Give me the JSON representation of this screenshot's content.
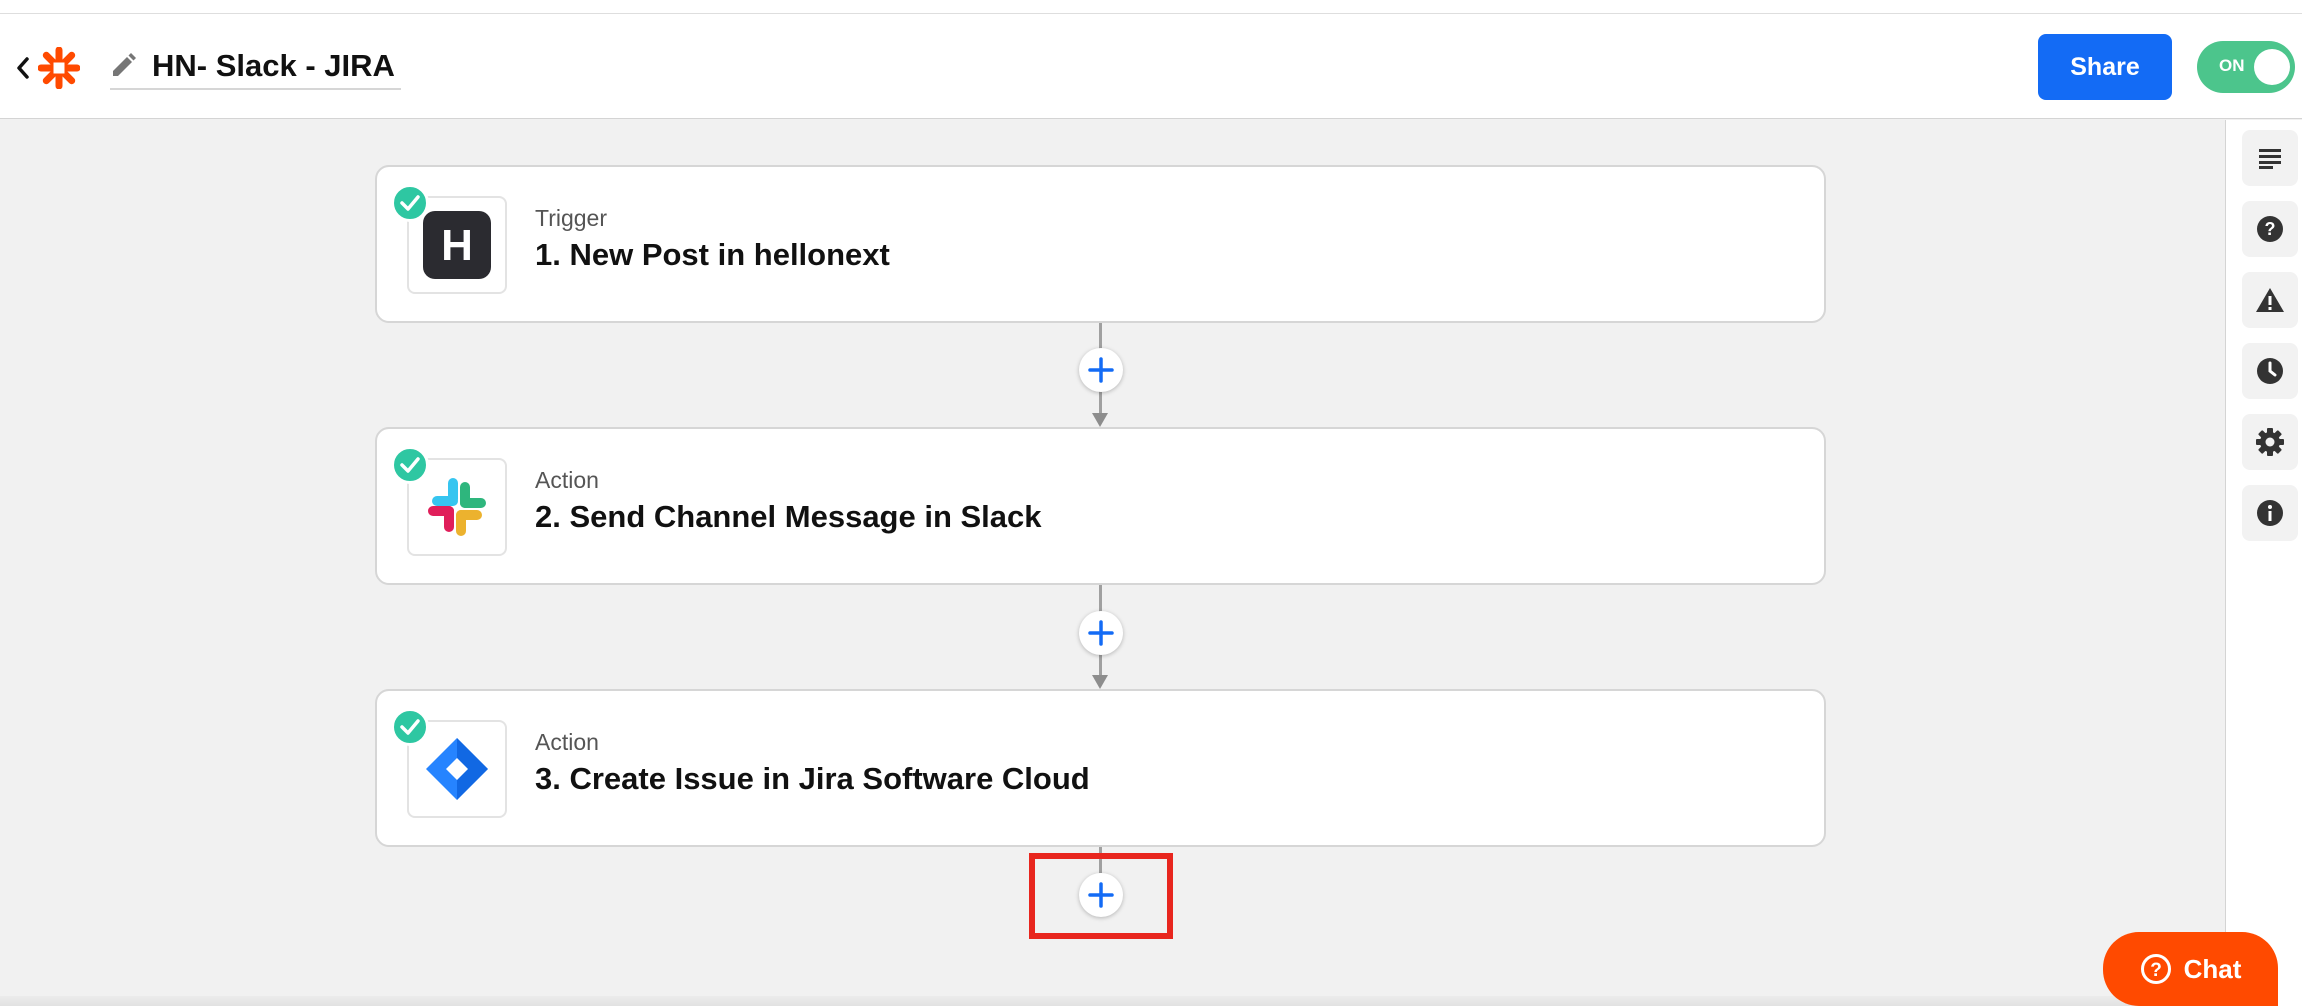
{
  "header": {
    "zap_title": "HN- Slack - JIRA",
    "share_label": "Share",
    "toggle_label": "ON",
    "toggle_on": true
  },
  "steps": [
    {
      "type": "Trigger",
      "title": "1. New Post in hellonext",
      "app": "hellonext",
      "icon_letter": "H",
      "status": "complete"
    },
    {
      "type": "Action",
      "title": "2. Send Channel Message in Slack",
      "app": "slack",
      "status": "complete"
    },
    {
      "type": "Action",
      "title": "3. Create Issue in Jira Software Cloud",
      "app": "jira",
      "status": "complete"
    }
  ],
  "sidebar": {
    "icons": [
      "details-icon",
      "help-icon",
      "warning-icon",
      "history-icon",
      "settings-icon",
      "info-icon"
    ]
  },
  "chat": {
    "label": "Chat"
  },
  "colors": {
    "accent": "#136bf5",
    "toggle_on": "#4cc58c",
    "check": "#2ec7a2",
    "zapier_orange": "#ff4a00",
    "highlight": "#e8261e"
  }
}
